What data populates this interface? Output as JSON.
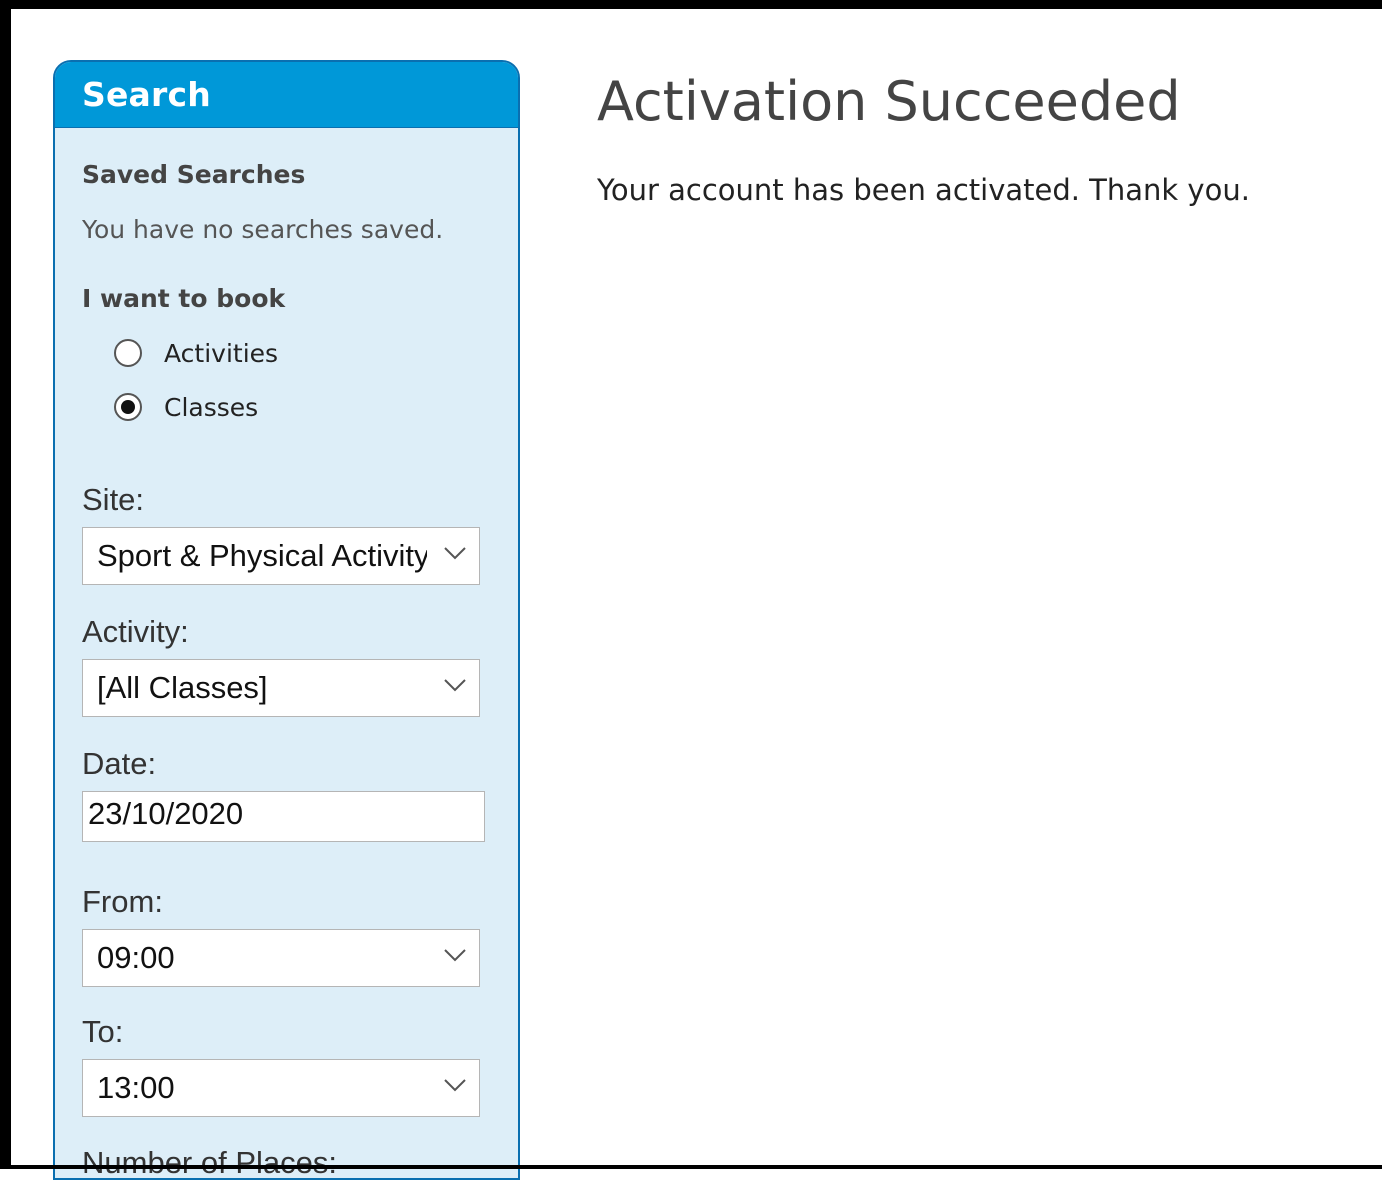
{
  "sidebar": {
    "title": "Search",
    "saved_searches_heading": "Saved Searches",
    "saved_searches_text": "You have no searches saved.",
    "book_heading": "I want to book",
    "book_options": [
      {
        "label": "Activities",
        "checked": false
      },
      {
        "label": "Classes",
        "checked": true
      }
    ],
    "site": {
      "label": "Site:",
      "value": "Sport & Physical Activity"
    },
    "activity": {
      "label": "Activity:",
      "value": "[All Classes]"
    },
    "date": {
      "label": "Date:",
      "value": "23/10/2020"
    },
    "from": {
      "label": "From:",
      "value": "09:00"
    },
    "to": {
      "label": "To:",
      "value": "13:00"
    },
    "places_label": "Number of Places:"
  },
  "main": {
    "title": "Activation Succeeded",
    "message": "Your account has been activated. Thank you."
  },
  "colors": {
    "header_blue": "#0098d8",
    "panel_bg": "#ddeef8",
    "panel_border": "#0a6fb0"
  }
}
